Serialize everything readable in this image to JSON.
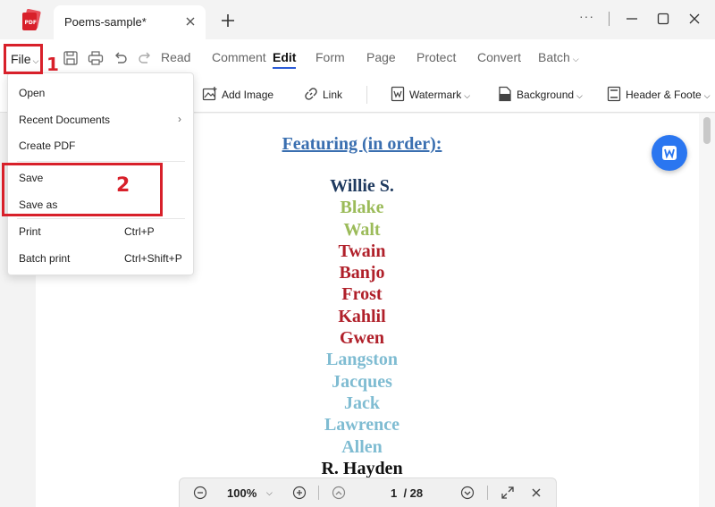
{
  "titlebar": {
    "tab_title": "Poems-sample*",
    "more_label": "···"
  },
  "toolbar": {
    "file_label": "File",
    "menu": [
      "Read",
      "Comment",
      "Edit",
      "Form",
      "Page",
      "Protect",
      "Convert",
      "Batch"
    ],
    "active_menu": "Edit"
  },
  "edit_tools": {
    "add_image": "Add Image",
    "link": "Link",
    "watermark": "Watermark",
    "background": "Background",
    "header_footer": "Header & Foote"
  },
  "file_menu": {
    "open": "Open",
    "recent_documents": "Recent Documents",
    "create_pdf": "Create PDF",
    "save": "Save",
    "save_as": "Save as",
    "print": "Print",
    "print_shortcut": "Ctrl+P",
    "batch_print": "Batch print",
    "batch_print_shortcut": "Ctrl+Shift+P"
  },
  "annotations": {
    "step1": "1",
    "step2": "2"
  },
  "document": {
    "heading": "Featuring (in order):",
    "names": [
      {
        "text": "Willie S.",
        "color": "#1f3a5f"
      },
      {
        "text": "Blake",
        "color": "#9bbb59"
      },
      {
        "text": "Walt",
        "color": "#9bbb59"
      },
      {
        "text": "Twain",
        "color": "#b0202a"
      },
      {
        "text": "Banjo",
        "color": "#b0202a"
      },
      {
        "text": "Frost",
        "color": "#b0202a"
      },
      {
        "text": "Kahlil",
        "color": "#b0202a"
      },
      {
        "text": "Gwen",
        "color": "#b0202a"
      },
      {
        "text": "Langston",
        "color": "#7fbcd2"
      },
      {
        "text": "Jacques",
        "color": "#7fbcd2"
      },
      {
        "text": "Jack",
        "color": "#7fbcd2"
      },
      {
        "text": "Lawrence",
        "color": "#7fbcd2"
      },
      {
        "text": "Allen",
        "color": "#7fbcd2"
      },
      {
        "text": "R. Hayden",
        "color": "#111111"
      }
    ]
  },
  "zoombar": {
    "zoom": "100%",
    "page_indicator": "1  / 28"
  },
  "colors": {
    "annotation_red": "#d8202a",
    "accent_blue": "#2a5bd7",
    "word_button_blue": "#2a76f0"
  }
}
